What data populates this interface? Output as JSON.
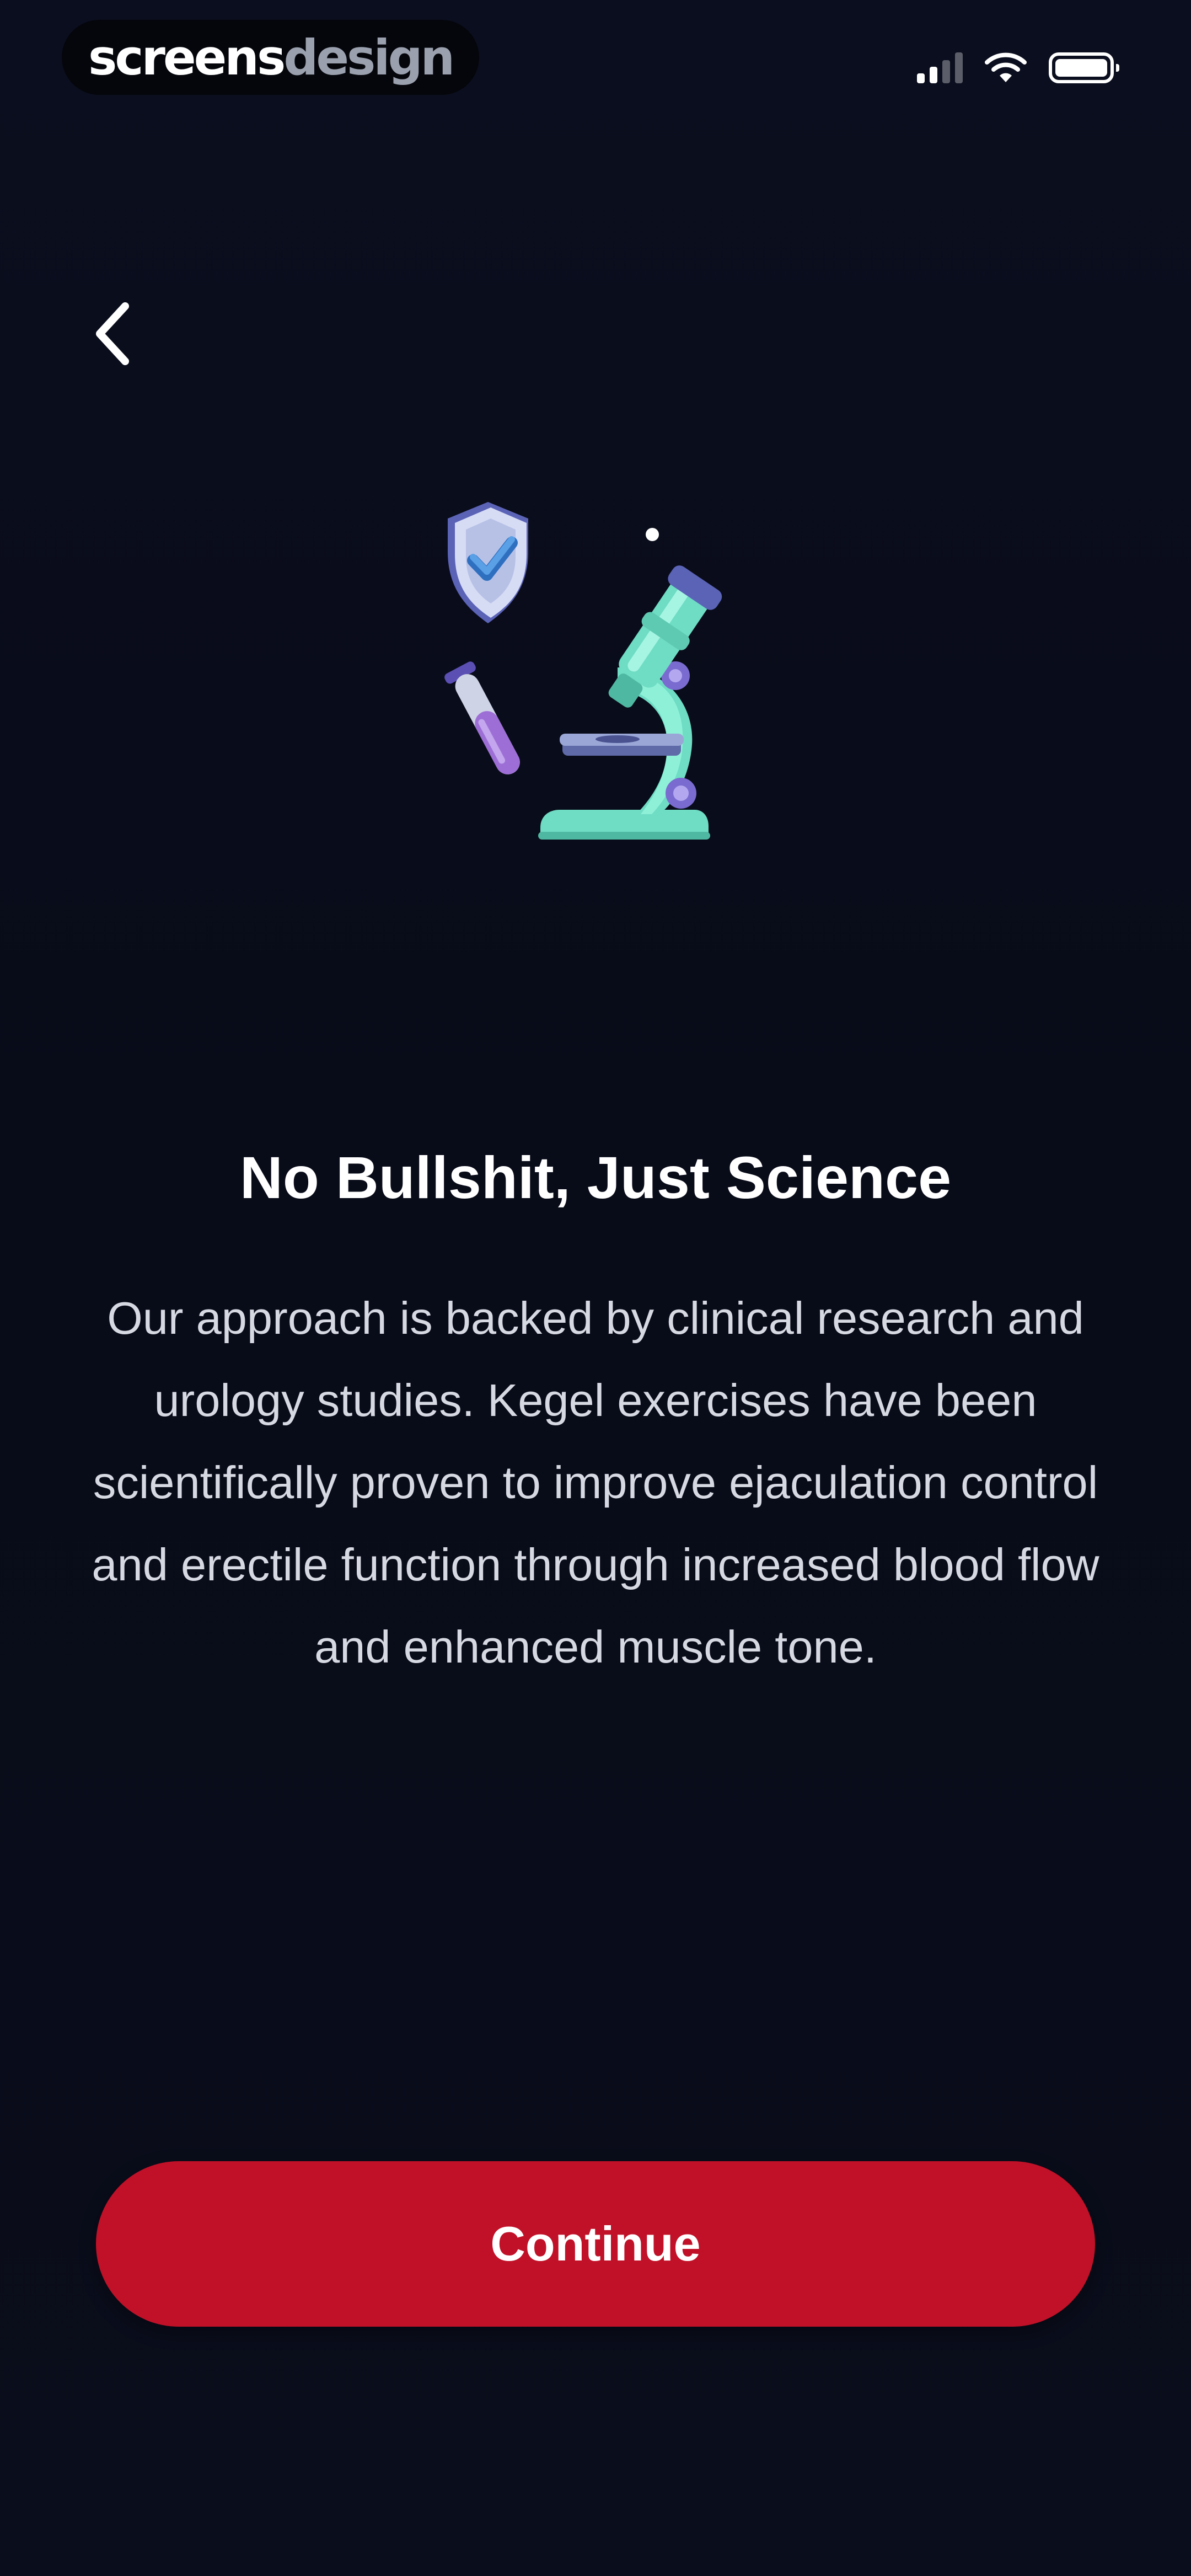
{
  "status_bar": {
    "brand_part1": "screens",
    "brand_part2": "design",
    "icons": [
      "cellular-signal-icon",
      "wifi-icon",
      "battery-icon"
    ]
  },
  "nav": {
    "back_icon": "chevron-left-icon"
  },
  "illustration": {
    "icons": [
      "shield-check-icon",
      "test-tube-icon",
      "microscope-icon"
    ],
    "colors": {
      "shield": "#c9d2ef",
      "check": "#4f8fd3",
      "tube_liquid": "#9d6fd6",
      "microscope": "#6fdcc4",
      "microscope_accent": "#7a6bd0"
    }
  },
  "content": {
    "title": "No Bullshit, Just Science",
    "body": "Our approach is backed by clinical research and urology studies. Kegel exercises have been scientifically proven to improve ejaculation control and erectile function through increased blood flow and enhanced muscle tone."
  },
  "actions": {
    "continue_label": "Continue"
  },
  "colors": {
    "background": "#0a0d1c",
    "accent": "#c01128",
    "title_text": "#ffffff",
    "body_text": "#d6d9e1"
  }
}
